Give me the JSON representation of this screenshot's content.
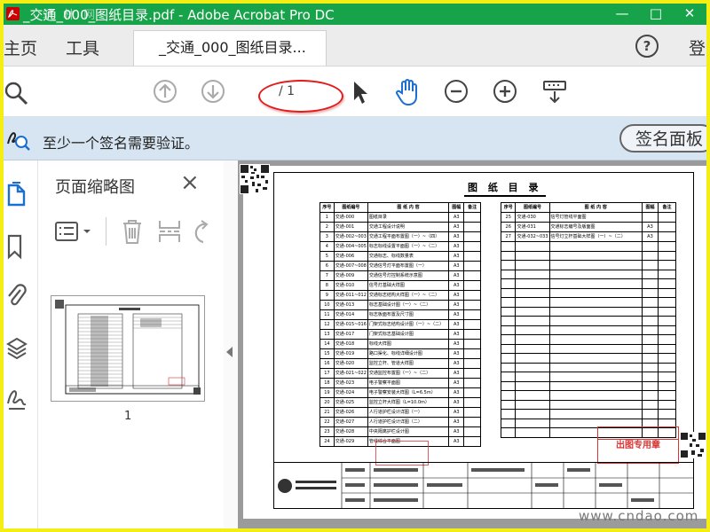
{
  "window": {
    "title": "_交通_000_图纸目录.pdf - Adobe Acrobat Pro DC",
    "watermark": "筑 林 网",
    "buttons": [
      "minimize",
      "restore",
      "close"
    ]
  },
  "tabs": {
    "home": "主页",
    "tools": "工具",
    "document": "_交通_000_图纸目录...",
    "document_close": "×",
    "login": "登"
  },
  "toolbar": {
    "page_info": "/ 1",
    "icons": [
      "search-icon",
      "prev-page-icon",
      "next-page-icon",
      "select-cursor-icon",
      "hand-tool-icon",
      "zoom-out-icon",
      "zoom-in-icon",
      "read-mode-icon"
    ]
  },
  "signature": {
    "message": "至少一个签名需要验证。",
    "button": "签名面板"
  },
  "thumbnails": {
    "title": "页面缩略图",
    "close": "×",
    "page_number": "1"
  },
  "drawing": {
    "title": "图 纸 目 录",
    "headers": {
      "seq": "序号",
      "code": "图纸编号",
      "content": "图 纸 内 容",
      "size": "图幅",
      "note": "备注"
    },
    "left_rows": [
      {
        "seq": "1",
        "code": "交通-000",
        "content": "图纸目录",
        "size": "A3"
      },
      {
        "seq": "2",
        "code": "交通-001",
        "content": "交通工程设计说明",
        "size": "A3"
      },
      {
        "seq": "3",
        "code": "交通-002~003",
        "content": "交通工程平面布置图（一）~（四）",
        "size": "A3"
      },
      {
        "seq": "4",
        "code": "交通-004~005",
        "content": "标志标线设置平面图（一）~（二）",
        "size": "A3"
      },
      {
        "seq": "5",
        "code": "交通-006",
        "content": "交通标志、标线数量表",
        "size": "A3"
      },
      {
        "seq": "6",
        "code": "交通-007~008",
        "content": "交通信号灯平面布置图（一）",
        "size": "A3"
      },
      {
        "seq": "7",
        "code": "交通-009",
        "content": "交通信号灯控制系统示意图",
        "size": "A3"
      },
      {
        "seq": "8",
        "code": "交通-010",
        "content": "信号灯基础大样图",
        "size": "A3"
      },
      {
        "seq": "9",
        "code": "交通-011~012",
        "content": "交通标志结构大样图（一）~（二）",
        "size": "A3"
      },
      {
        "seq": "10",
        "code": "交通-013",
        "content": "标志基础设计图（一）~（二）",
        "size": "A3"
      },
      {
        "seq": "11",
        "code": "交通-014",
        "content": "标志板面布置及尺寸图",
        "size": "A3"
      },
      {
        "seq": "12",
        "code": "交通-015~016",
        "content": "门架式标志结构设计图（一）~（二）",
        "size": "A3"
      },
      {
        "seq": "13",
        "code": "交通-017",
        "content": "门架式标志基础设计图",
        "size": "A3"
      },
      {
        "seq": "14",
        "code": "交通-018",
        "content": "标线大样图",
        "size": "A3"
      },
      {
        "seq": "15",
        "code": "交通-019",
        "content": "路口渠化、标线详细设计图",
        "size": "A3"
      },
      {
        "seq": "16",
        "code": "交通-020",
        "content": "监控立杆、管道大样图",
        "size": "A3"
      },
      {
        "seq": "17",
        "code": "交通-021~022",
        "content": "交通监控布置图（一）~（二）",
        "size": "A3"
      },
      {
        "seq": "18",
        "code": "交通-023",
        "content": "电子警察平面图",
        "size": "A3"
      },
      {
        "seq": "19",
        "code": "交通-024",
        "content": "电子警察安装大样图（L=6.5m）",
        "size": "A3"
      },
      {
        "seq": "20",
        "code": "交通-025",
        "content": "监控立杆大样图（L=10.0m）",
        "size": "A3"
      },
      {
        "seq": "21",
        "code": "交通-026",
        "content": "人行道护栏设计详图（一）",
        "size": "A3"
      },
      {
        "seq": "22",
        "code": "交通-027",
        "content": "人行道护栏设计详图（二）",
        "size": "A3"
      },
      {
        "seq": "23",
        "code": "交通-028",
        "content": "中央隔离护栏设计图",
        "size": "A3"
      },
      {
        "seq": "24",
        "code": "交通-029",
        "content": "管线综合平面图",
        "size": "A3"
      }
    ],
    "right_rows": [
      {
        "seq": "25",
        "code": "交通-030",
        "content": "信号灯管线平面图",
        "size": ""
      },
      {
        "seq": "26",
        "code": "交通-031",
        "content": "交通标志编号及版面图",
        "size": "A3"
      },
      {
        "seq": "27",
        "code": "交通-032~033",
        "content": "信号灯立杆基础大样图（一）~（二）",
        "size": "A3"
      }
    ],
    "stamp_text": "出图专用章",
    "bottom_watermark": "www.cndao.com"
  }
}
